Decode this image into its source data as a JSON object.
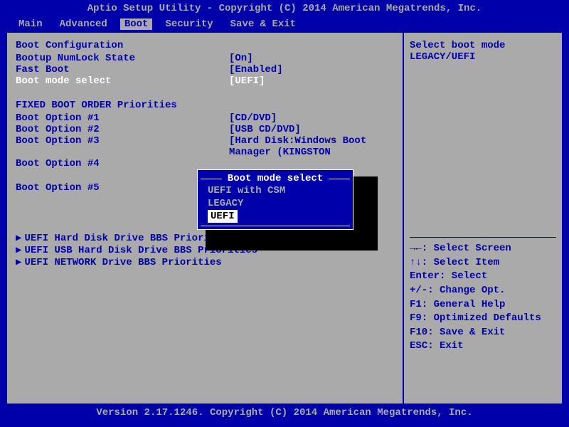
{
  "title": "Aptio Setup Utility - Copyright (C) 2014 American Megatrends, Inc.",
  "footer": "Version 2.17.1246. Copyright (C) 2014 American Megatrends, Inc.",
  "menu": {
    "items": [
      "Main",
      "Advanced",
      "Boot",
      "Security",
      "Save & Exit"
    ],
    "selected": "Boot"
  },
  "left": {
    "section1_title": "Boot Configuration",
    "settings": [
      {
        "label": "Bootup NumLock State",
        "value": "[On]"
      },
      {
        "label": "Fast Boot",
        "value": "[Enabled]"
      },
      {
        "label": "Boot mode select",
        "value": "[UEFI]",
        "selected": true
      }
    ],
    "section2_title": "FIXED BOOT ORDER Priorities",
    "boot_options": [
      {
        "label": "Boot Option #1",
        "value": "[CD/DVD]"
      },
      {
        "label": "Boot Option #2",
        "value": "[USB CD/DVD]"
      },
      {
        "label": "Boot Option #3",
        "value": "[Hard Disk:Windows Boot"
      },
      {
        "label": "",
        "value": "Manager (KINGSTON"
      },
      {
        "label": "Boot Option #4",
        "value": ""
      },
      {
        "label": "",
        "value": ""
      },
      {
        "label": "Boot Option #5",
        "value": ""
      }
    ],
    "submenus": [
      "UEFI Hard Disk Drive BBS Priorities",
      "UEFI USB Hard Disk Drive BBS Priorities",
      "UEFI NETWORK Drive BBS Priorities"
    ]
  },
  "right": {
    "help1": "Select boot mode",
    "help2": "LEGACY/UEFI",
    "keys": [
      "→←: Select Screen",
      "↑↓: Select Item",
      "Enter: Select",
      "+/-: Change Opt.",
      "F1: General Help",
      "F9: Optimized Defaults",
      "F10: Save & Exit",
      "ESC: Exit"
    ]
  },
  "popup": {
    "title": "Boot mode select",
    "options": [
      "UEFI with CSM",
      "LEGACY",
      "UEFI"
    ],
    "selected": "UEFI"
  }
}
